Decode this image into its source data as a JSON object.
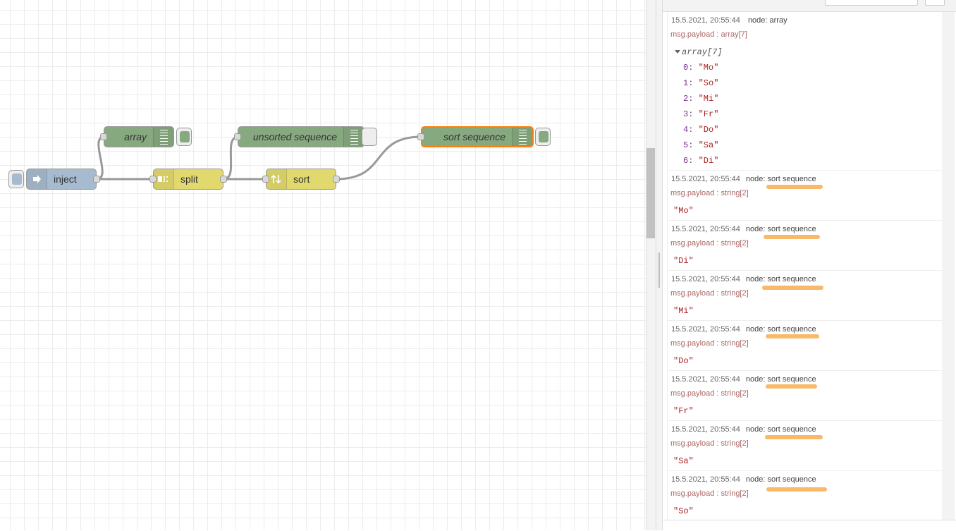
{
  "flow": {
    "nodes": {
      "inject": {
        "label": "inject",
        "color": "#a6bbcf"
      },
      "array": {
        "label": "array",
        "color": "#87a980"
      },
      "split": {
        "label": "split",
        "color": "#e2d96e"
      },
      "unsorted": {
        "label": "unsorted sequence",
        "color": "#87a980"
      },
      "sort": {
        "label": "sort",
        "color": "#e2d96e"
      },
      "sort_sequence": {
        "label": "sort sequence",
        "color": "#87a980",
        "selected": true,
        "selected_color": "#ff7f0e"
      }
    }
  },
  "debug": {
    "array_message": {
      "timestamp": "15.5.2021, 20:55:44",
      "node_prefix": "node:",
      "node_name": "array",
      "topic": "msg.payload : array[7]",
      "tree_label": "array[7]",
      "items": [
        {
          "key": "0:",
          "value": "\"Mo\""
        },
        {
          "key": "1:",
          "value": "\"So\""
        },
        {
          "key": "2:",
          "value": "\"Mi\""
        },
        {
          "key": "3:",
          "value": "\"Fr\""
        },
        {
          "key": "4:",
          "value": "\"Do\""
        },
        {
          "key": "5:",
          "value": "\"Sa\""
        },
        {
          "key": "6:",
          "value": "\"Di\""
        }
      ]
    },
    "sequence_messages": [
      {
        "timestamp": "15.5.2021, 20:55:44",
        "node_prefix": "node:",
        "node_name": "sort sequence",
        "topic": "msg.payload : string[2]",
        "value": "\"Mo\""
      },
      {
        "timestamp": "15.5.2021, 20:55:44",
        "node_prefix": "node:",
        "node_name": "sort sequence",
        "topic": "msg.payload : string[2]",
        "value": "\"Di\""
      },
      {
        "timestamp": "15.5.2021, 20:55:44",
        "node_prefix": "node:",
        "node_name": "sort sequence",
        "topic": "msg.payload : string[2]",
        "value": "\"Mi\""
      },
      {
        "timestamp": "15.5.2021, 20:55:44",
        "node_prefix": "node:",
        "node_name": "sort sequence",
        "topic": "msg.payload : string[2]",
        "value": "\"Do\""
      },
      {
        "timestamp": "15.5.2021, 20:55:44",
        "node_prefix": "node:",
        "node_name": "sort sequence",
        "topic": "msg.payload : string[2]",
        "value": "\"Fr\""
      },
      {
        "timestamp": "15.5.2021, 20:55:44",
        "node_prefix": "node:",
        "node_name": "sort sequence",
        "topic": "msg.payload : string[2]",
        "value": "\"Sa\""
      },
      {
        "timestamp": "15.5.2021, 20:55:44",
        "node_prefix": "node:",
        "node_name": "sort sequence",
        "topic": "msg.payload : string[2]",
        "value": "\"So\""
      }
    ],
    "highlight_color": "#f7b25a"
  }
}
